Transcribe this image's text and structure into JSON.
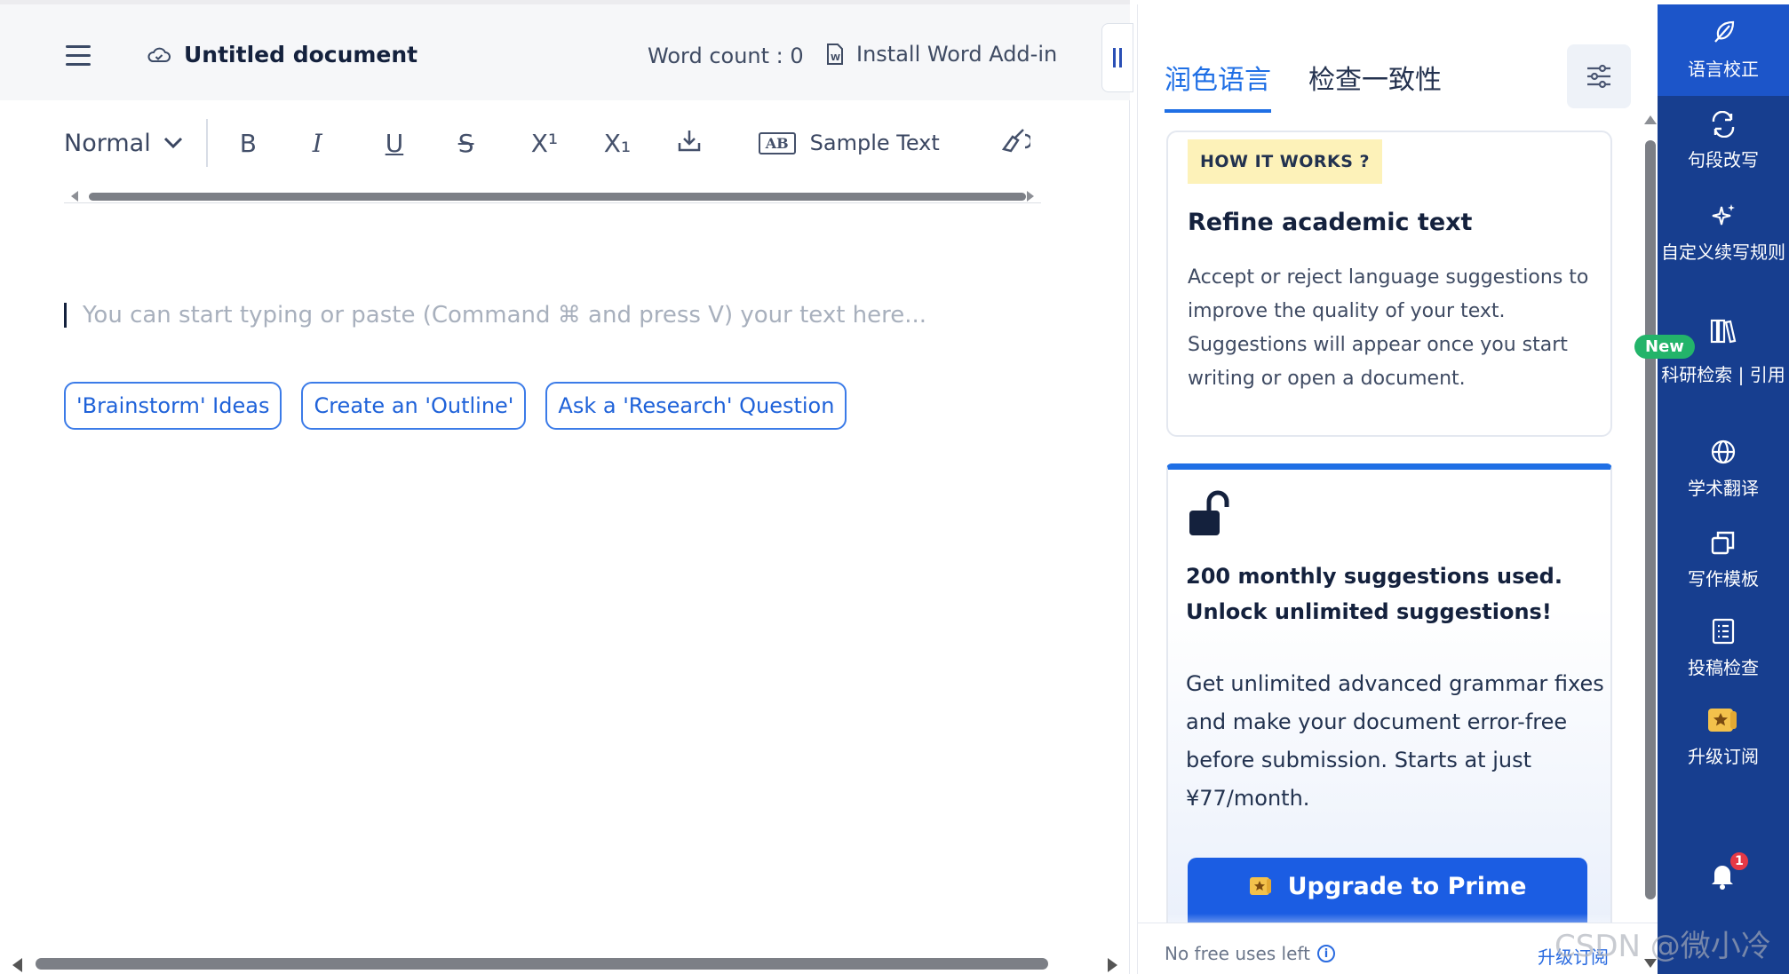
{
  "header": {
    "doc_title": "Untitled document",
    "word_count": "Word count : 0",
    "install_addin": "Install Word Add-in"
  },
  "toolbar": {
    "style_select": "Normal",
    "bold": "B",
    "italic": "I",
    "underline": "U",
    "strikethrough": "S",
    "superscript": "X¹",
    "subscript": "X₁",
    "sample_badge": "AB",
    "sample_text": "Sample Text"
  },
  "editor": {
    "placeholder": "You can start typing or paste (Command ⌘ and press V) your text here...",
    "chips": [
      "'Brainstorm' Ideas",
      "Create an 'Outline'",
      "Ask a 'Research' Question"
    ]
  },
  "panel": {
    "tabs": [
      "润色语言",
      "检查一致性"
    ],
    "active_tab": "润色语言",
    "how_it_works": "HOW IT WORKS ?",
    "card_title": "Refine academic text",
    "card_desc": "Accept or reject language suggestions to improve the quality of your text. Suggestions will appear once you start writing or open a document.",
    "upgrade_headline_1": "200 monthly suggestions used.",
    "upgrade_headline_2": "Unlock unlimited suggestions!",
    "upgrade_body": "Get unlimited advanced grammar fixes and make your document error-free before submission. Starts at just ¥77/month.",
    "upgrade_button": "Upgrade to Prime",
    "footer_note": "No free uses left",
    "footer_link": "升级订阅"
  },
  "sidenav": {
    "items": [
      {
        "label": "语言校正",
        "icon": "feather-pen-icon"
      },
      {
        "label": "句段改写",
        "icon": "rewrite-arrows-icon"
      },
      {
        "label": "自定义续写规则",
        "icon": "sparkle-icon"
      },
      {
        "label": "科研检索 | 引用",
        "icon": "library-books-icon"
      },
      {
        "label": "学术翻译",
        "icon": "globe-icon"
      },
      {
        "label": "写作模板",
        "icon": "template-icon"
      },
      {
        "label": "投稿检查",
        "icon": "checklist-icon"
      },
      {
        "label": "升级订阅",
        "icon": "star-ticket-icon"
      }
    ],
    "new_badge": "New",
    "notification_count": "1"
  },
  "watermark": "CSDN @微小冷",
  "colors": {
    "primary": "#1f6fe5",
    "nav_bg": "#173e8f",
    "nav_active": "#1c55c9",
    "new_badge": "#23b46a",
    "how_it_works_bg": "#fdf2b9"
  }
}
